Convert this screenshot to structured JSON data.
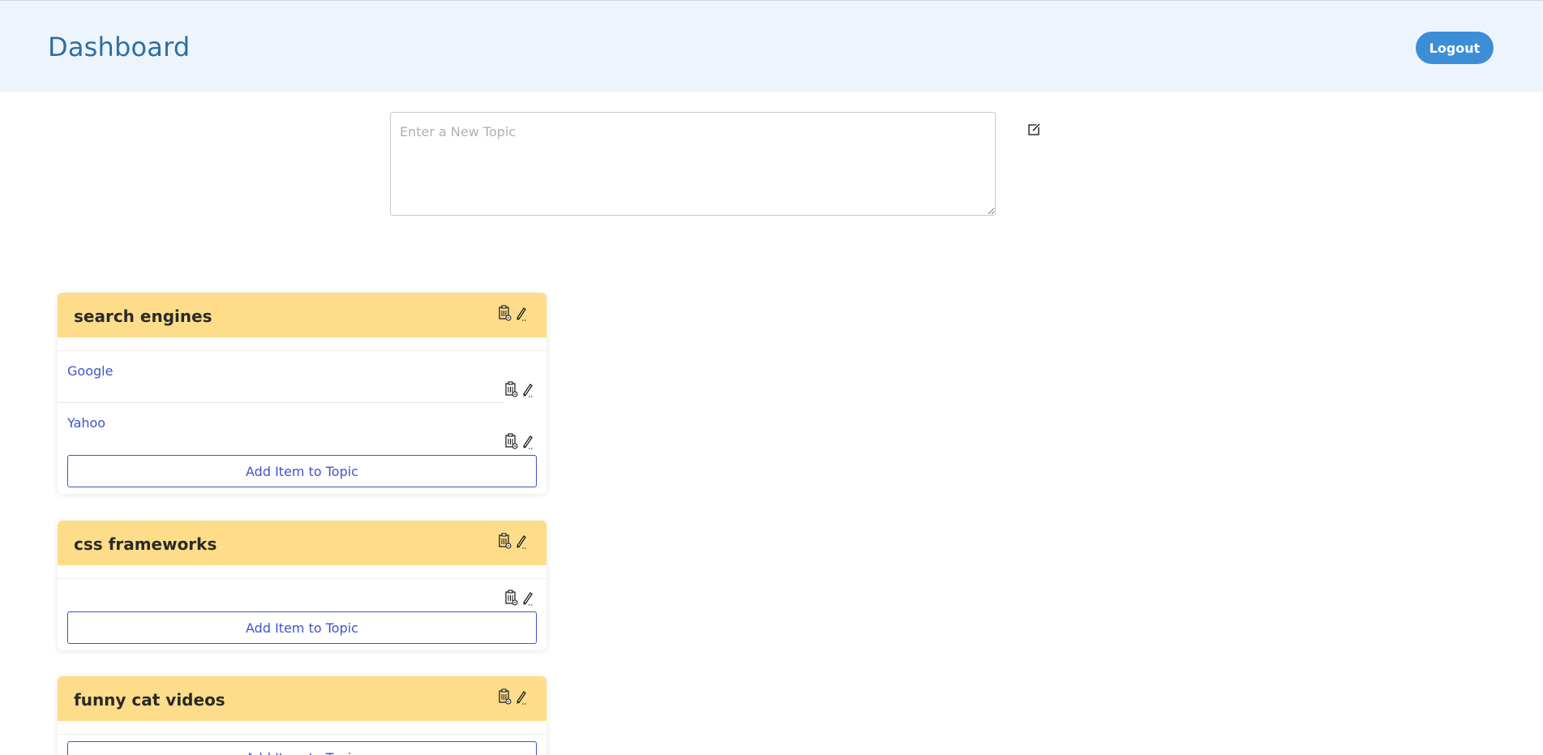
{
  "header": {
    "title": "Dashboard",
    "logout_label": "Logout"
  },
  "new_topic": {
    "placeholder": "Enter a New Topic"
  },
  "topics": [
    {
      "title": "search engines",
      "items": [
        "Google",
        "Yahoo"
      ],
      "add_label": "Add Item to Topic"
    },
    {
      "title": "css frameworks",
      "items": [],
      "add_label": "Add Item to Topic"
    },
    {
      "title": "funny cat videos",
      "items": [],
      "add_label": "Add Item to Topic"
    }
  ],
  "colors": {
    "header_bg": "#eef4fb",
    "title": "#2a6fa8",
    "logout_bg": "#3c8ed6",
    "card_head": "#fedd8a",
    "link": "#3d55c9"
  },
  "icons": {
    "new_topic": "edit-square-icon",
    "delete": "clipboard-delete-icon",
    "edit": "pencil-icon"
  }
}
